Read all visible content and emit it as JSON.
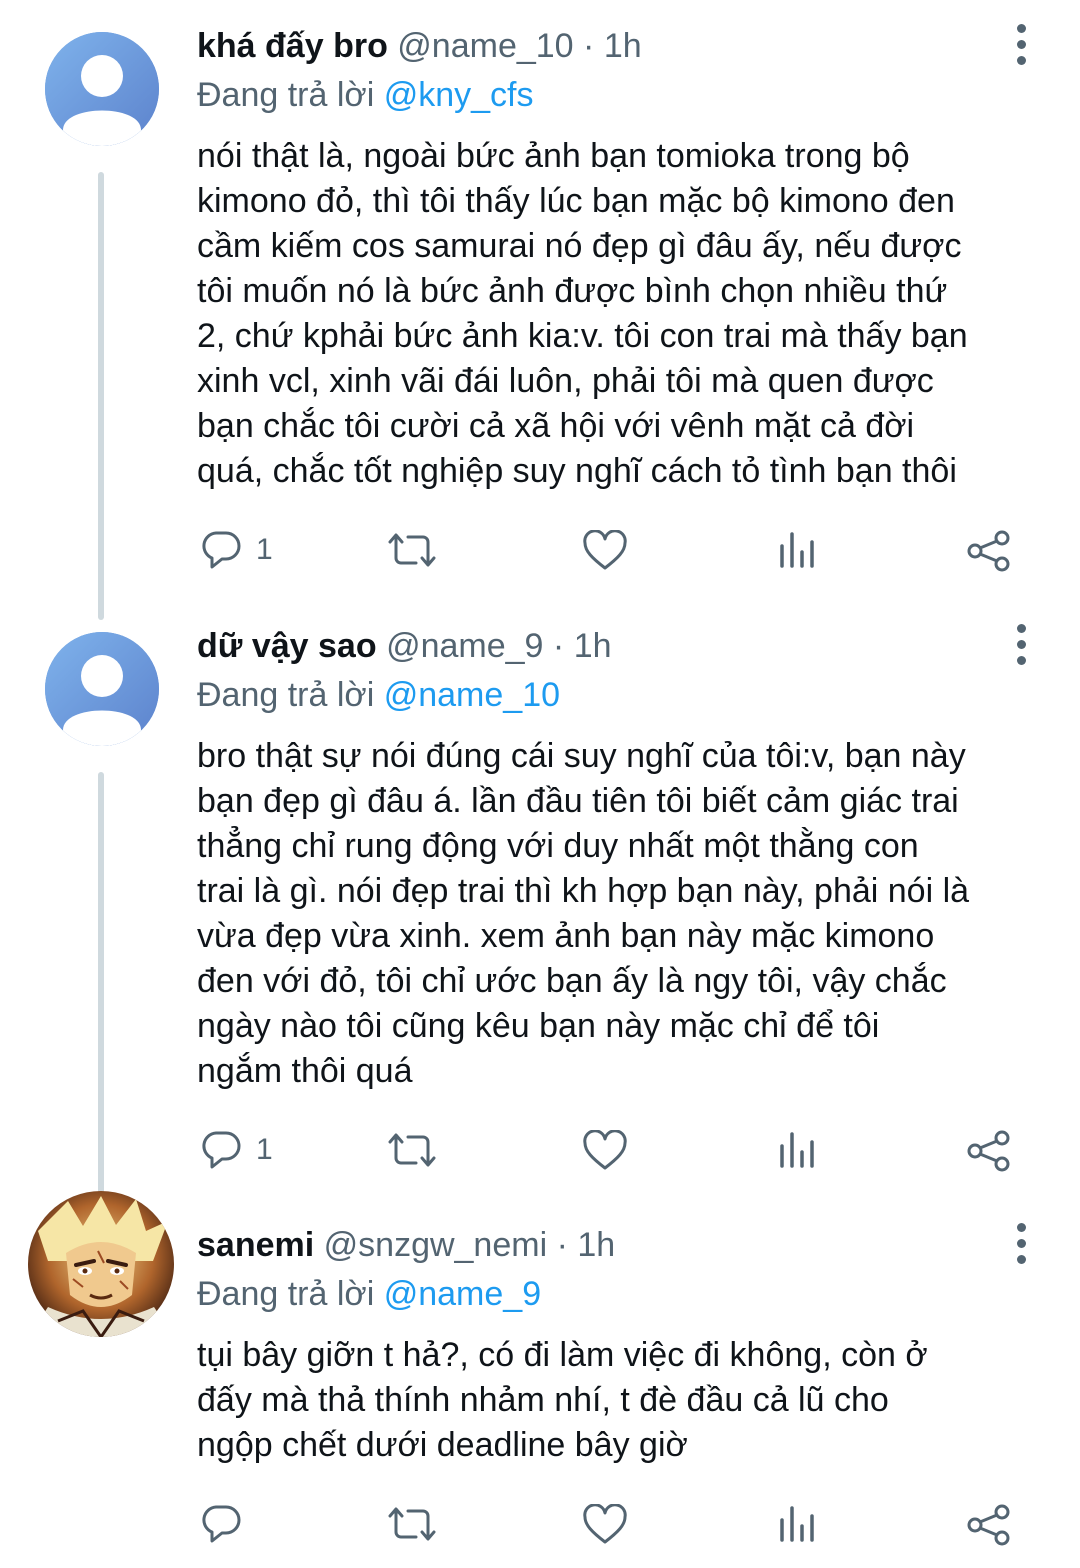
{
  "tweets": [
    {
      "name": "khá đấy bro",
      "handle": "@name_10",
      "sep": "·",
      "time": "1h",
      "replying_prefix": "Đang trả lời",
      "replying_to": "@kny_cfs",
      "lines": [
        "nói thật là, ngoài bức ảnh bạn tomioka trong bộ",
        "kimono đỏ, thì tôi thấy lúc bạn mặc bộ kimono đen",
        "cầm kiếm cos samurai nó đẹp gì đâu ấy, nếu được",
        "tôi muốn nó là bức ảnh được bình chọn nhiều thứ",
        "2, chứ kphải bức ảnh kia:v. tôi con trai mà thấy bạn",
        "xinh vcl, xinh vãi đái luôn, phải tôi mà quen được",
        "bạn chắc tôi cười cả xã hội với vênh mặt cả đời",
        "quá, chắc tốt nghiệp suy nghĩ cách tỏ tình bạn thôi"
      ],
      "reply_count": "1"
    },
    {
      "name": "dữ vậy sao",
      "handle": "@name_9",
      "sep": "·",
      "time": "1h",
      "replying_prefix": "Đang trả lời",
      "replying_to": "@name_10",
      "lines": [
        "bro thật sự nói đúng cái suy nghĩ của tôi:v, bạn này",
        "bạn đẹp gì đâu á. lần đầu tiên tôi biết cảm giác trai",
        "thẳng chỉ rung động với duy nhất một thằng con",
        "trai là gì. nói đẹp trai thì kh hợp bạn này, phải nói là",
        "vừa đẹp vừa xinh. xem ảnh bạn này mặc kimono",
        "đen với đỏ, tôi chỉ ước bạn ấy là ngy tôi, vậy chắc",
        "ngày nào tôi cũng kêu bạn này mặc chỉ để tôi",
        "ngắm thôi quá"
      ],
      "reply_count": "1"
    },
    {
      "name": "sanemi",
      "handle": "@snzgw_nemi",
      "sep": "·",
      "time": "1h",
      "replying_prefix": "Đang trả lời",
      "replying_to": "@name_9",
      "lines": [
        "tụi bây giỡn t hả?, có đi làm việc đi không, còn ở",
        "đấy mà thả thính nhảm nhí, t đè đầu cả lũ cho",
        "ngộp chết dưới deadline bây giờ"
      ],
      "reply_count": ""
    }
  ],
  "icons": {
    "reply": "reply-icon",
    "retweet": "retweet-icon",
    "like": "heart-icon",
    "views": "analytics-icon",
    "share": "share-icon",
    "more": "more-vertical-icon",
    "avatar_default": "default-avatar-icon"
  },
  "colors": {
    "mention": "#1d9bf0",
    "secondary_text": "#536471",
    "thread_line": "#cfd9de",
    "default_avatar": "#6f9ed9"
  }
}
